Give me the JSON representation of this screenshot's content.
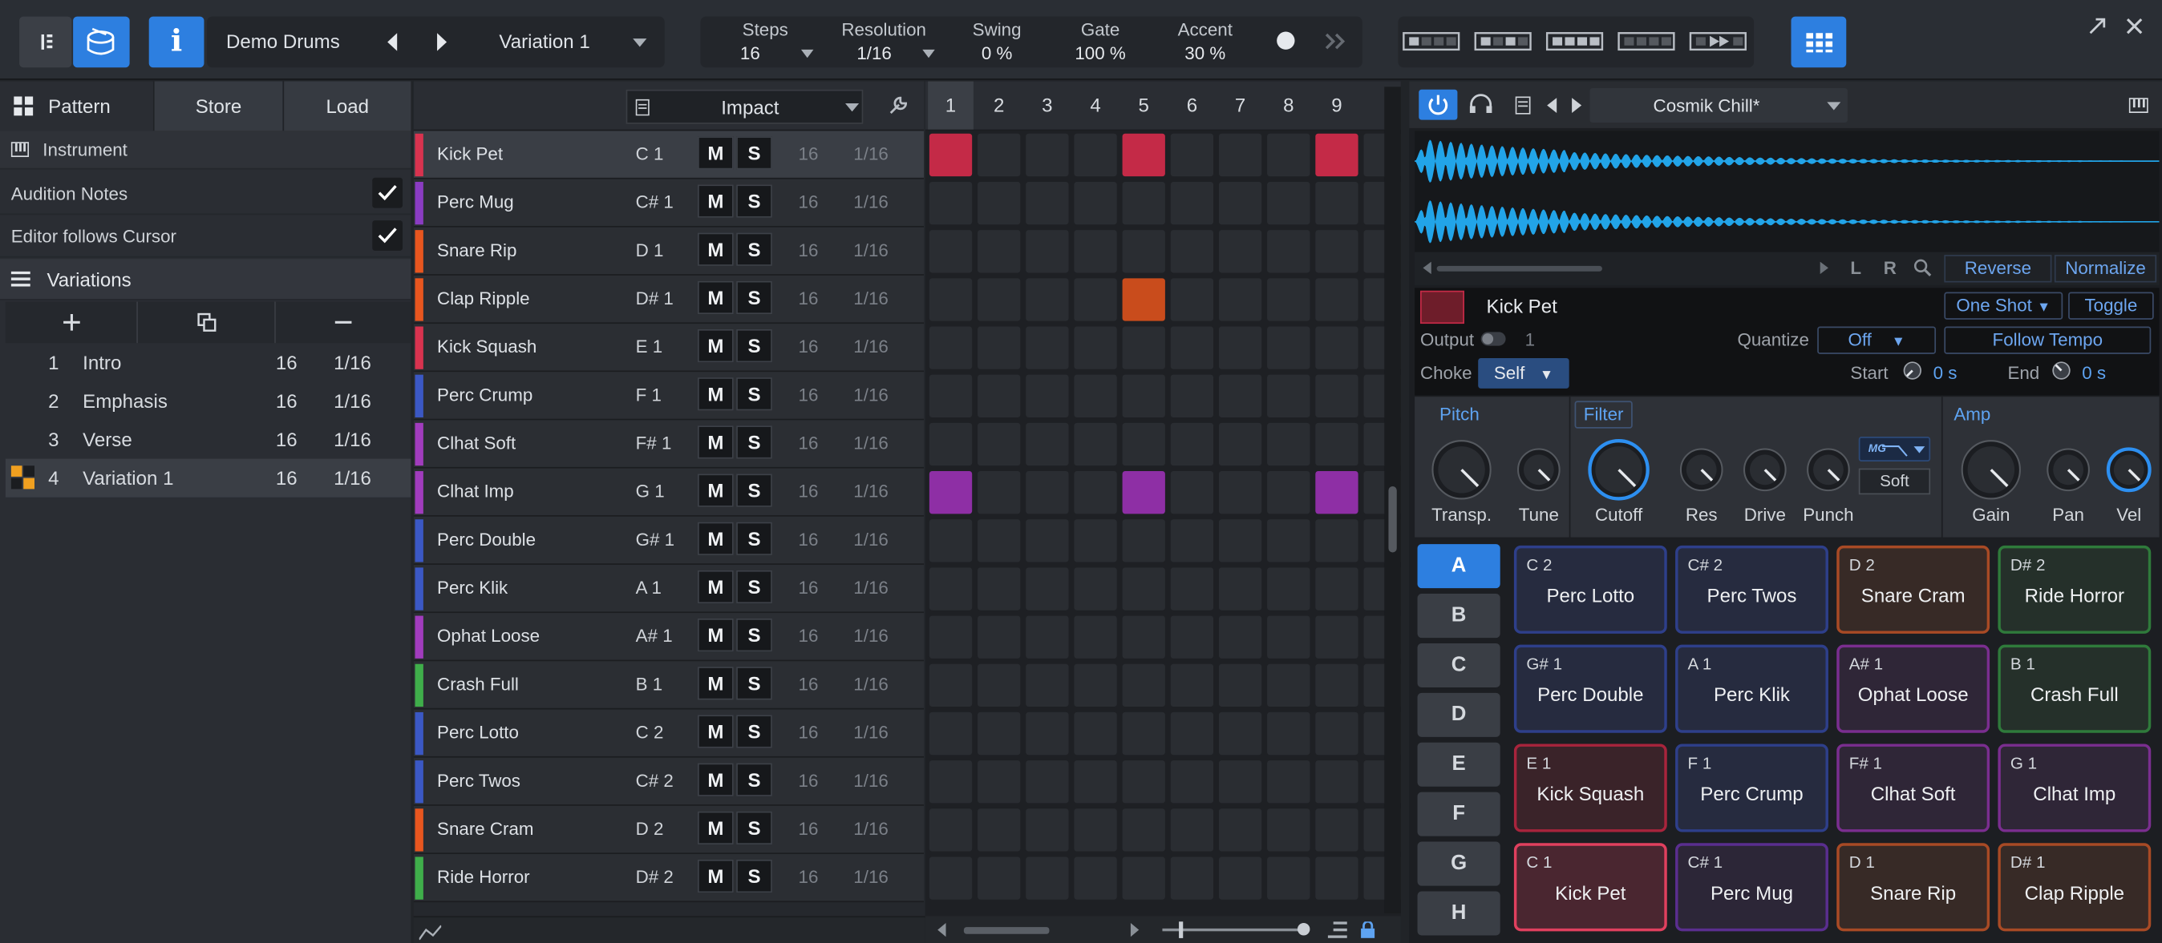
{
  "topbar": {
    "instrument": "Demo Drums",
    "variation": "Variation 1",
    "info": "i",
    "steps_label": "Steps",
    "steps": "16",
    "resolution_label": "Resolution",
    "resolution": "1/16",
    "swing_label": "Swing",
    "swing": "0 %",
    "gate_label": "Gate",
    "gate": "100 %",
    "accent_label": "Accent",
    "accent": "30 %"
  },
  "left": {
    "tabs": [
      "Pattern",
      "Store",
      "Load"
    ],
    "instrument_label": "Instrument",
    "audition": "Audition Notes",
    "follow": "Editor follows Cursor",
    "variations_title": "Variations",
    "variations": [
      {
        "n": "1",
        "name": "Intro",
        "steps": "16",
        "res": "1/16"
      },
      {
        "n": "2",
        "name": "Emphasis",
        "steps": "16",
        "res": "1/16"
      },
      {
        "n": "3",
        "name": "Verse",
        "steps": "16",
        "res": "1/16"
      },
      {
        "n": "4",
        "name": "Variation 1",
        "steps": "16",
        "res": "1/16"
      }
    ]
  },
  "list": {
    "kit": "Impact",
    "m": "M",
    "s": "S",
    "rows": [
      {
        "name": "Kick Pet",
        "note": "C 1",
        "steps": "16",
        "res": "1/16",
        "color": "#d8334f"
      },
      {
        "name": "Perc Mug",
        "note": "C# 1",
        "steps": "16",
        "res": "1/16",
        "color": "#8a3cc2"
      },
      {
        "name": "Snare Rip",
        "note": "D 1",
        "steps": "16",
        "res": "1/16",
        "color": "#e8561f"
      },
      {
        "name": "Clap Ripple",
        "note": "D# 1",
        "steps": "16",
        "res": "1/16",
        "color": "#e8561f"
      },
      {
        "name": "Kick Squash",
        "note": "E 1",
        "steps": "16",
        "res": "1/16",
        "color": "#d8334f"
      },
      {
        "name": "Perc Crump",
        "note": "F 1",
        "steps": "16",
        "res": "1/16",
        "color": "#3b58c4"
      },
      {
        "name": "Clhat Soft",
        "note": "F# 1",
        "steps": "16",
        "res": "1/16",
        "color": "#a13cbd"
      },
      {
        "name": "Clhat Imp",
        "note": "G 1",
        "steps": "16",
        "res": "1/16",
        "color": "#a13cbd"
      },
      {
        "name": "Perc Double",
        "note": "G# 1",
        "steps": "16",
        "res": "1/16",
        "color": "#3b58c4"
      },
      {
        "name": "Perc Klik",
        "note": "A 1",
        "steps": "16",
        "res": "1/16",
        "color": "#3b58c4"
      },
      {
        "name": "Ophat Loose",
        "note": "A# 1",
        "steps": "16",
        "res": "1/16",
        "color": "#a13cbd"
      },
      {
        "name": "Crash Full",
        "note": "B 1",
        "steps": "16",
        "res": "1/16",
        "color": "#3fae4a"
      },
      {
        "name": "Perc Lotto",
        "note": "C 2",
        "steps": "16",
        "res": "1/16",
        "color": "#3b58c4"
      },
      {
        "name": "Perc Twos",
        "note": "C# 2",
        "steps": "16",
        "res": "1/16",
        "color": "#3b58c4"
      },
      {
        "name": "Snare Cram",
        "note": "D 2",
        "steps": "16",
        "res": "1/16",
        "color": "#e8561f"
      },
      {
        "name": "Ride Horror",
        "note": "D# 2",
        "steps": "16",
        "res": "1/16",
        "color": "#3fae4a"
      }
    ]
  },
  "grid": {
    "columns": [
      "1",
      "2",
      "3",
      "4",
      "5",
      "6",
      "7",
      "8",
      "9"
    ],
    "active": [
      {
        "row": 0,
        "col": 0,
        "color": "#c42a47"
      },
      {
        "row": 0,
        "col": 4,
        "color": "#c42a47"
      },
      {
        "row": 0,
        "col": 8,
        "color": "#c42a47"
      },
      {
        "row": 3,
        "col": 4,
        "color": "#c94c1c"
      },
      {
        "row": 7,
        "col": 0,
        "color": "#8e2fa5"
      },
      {
        "row": 7,
        "col": 4,
        "color": "#8e2fa5"
      },
      {
        "row": 7,
        "col": 8,
        "color": "#8e2fa5"
      }
    ]
  },
  "right": {
    "preset": "Cosmik Chill*",
    "l": "L",
    "r": "R",
    "reverse": "Reverse",
    "normalize": "Normalize",
    "sample": "Kick Pet",
    "mode": "One Shot",
    "toggle": "Toggle",
    "output_label": "Output",
    "output": "1",
    "quantize_label": "Quantize",
    "quantize": "Off",
    "follow_tempo": "Follow Tempo",
    "choke_label": "Choke",
    "choke": "Self",
    "start_label": "Start",
    "start": "0 s",
    "end_label": "End",
    "end": "0 s",
    "pitch": "Pitch",
    "filter": "Filter",
    "amp": "Amp",
    "filter_type": "MG",
    "soft": "Soft",
    "knobs": [
      "Transp.",
      "Tune",
      "Cutoff",
      "Res",
      "Drive",
      "Punch",
      "Gain",
      "Pan",
      "Vel"
    ],
    "banks": [
      "A",
      "B",
      "C",
      "D",
      "E",
      "F",
      "G",
      "H"
    ],
    "pads": [
      [
        {
          "note": "C 2",
          "name": "Perc Lotto",
          "color": "#2e3f8a",
          "bg": "#262b3f"
        },
        {
          "note": "C# 2",
          "name": "Perc Twos",
          "color": "#2e3f8a",
          "bg": "#262b3f"
        },
        {
          "note": "D 2",
          "name": "Snare Cram",
          "color": "#a84a25",
          "bg": "#372a26"
        },
        {
          "note": "D# 2",
          "name": "Ride Horror",
          "color": "#2f7a3b",
          "bg": "#25302a"
        }
      ],
      [
        {
          "note": "G# 1",
          "name": "Perc Double",
          "color": "#2e3f8a",
          "bg": "#262b3f"
        },
        {
          "note": "A 1",
          "name": "Perc Klik",
          "color": "#2e3f8a",
          "bg": "#262b3f"
        },
        {
          "note": "A# 1",
          "name": "Ophat Loose",
          "color": "#7a2e8f",
          "bg": "#2f2637"
        },
        {
          "note": "B 1",
          "name": "Crash Full",
          "color": "#2f7a3b",
          "bg": "#25302a"
        }
      ],
      [
        {
          "note": "E 1",
          "name": "Kick Squash",
          "color": "#a8243c",
          "bg": "#3a2329"
        },
        {
          "note": "F 1",
          "name": "Perc Crump",
          "color": "#2e3f8a",
          "bg": "#262b3f"
        },
        {
          "note": "F# 1",
          "name": "Clhat Soft",
          "color": "#7a2e8f",
          "bg": "#2f2637"
        },
        {
          "note": "G 1",
          "name": "Clhat Imp",
          "color": "#7a2e8f",
          "bg": "#2f2637"
        }
      ],
      [
        {
          "note": "C 1",
          "name": "Kick Pet",
          "color": "#e0405e",
          "bg": "#4a2630"
        },
        {
          "note": "C# 1",
          "name": "Perc Mug",
          "color": "#5a2e8f",
          "bg": "#2c2637"
        },
        {
          "note": "D 1",
          "name": "Snare Rip",
          "color": "#a84a25",
          "bg": "#372a26"
        },
        {
          "note": "D# 1",
          "name": "Clap Ripple",
          "color": "#a84a25",
          "bg": "#372a26"
        }
      ]
    ]
  }
}
